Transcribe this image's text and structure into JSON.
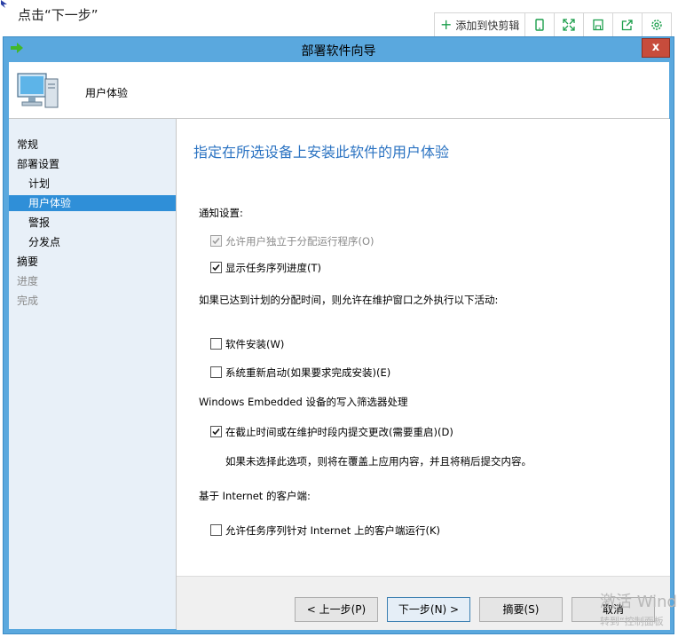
{
  "caption": "点击“下一步”",
  "toolbar": {
    "add_label": "添加到快剪辑",
    "icons": [
      "phone-icon",
      "expand-icon",
      "save-icon",
      "share-icon",
      "settings-icon"
    ]
  },
  "window": {
    "title": "部署软件向导",
    "close_label": "x",
    "header_title": "用户体验"
  },
  "nav": {
    "items": [
      {
        "label": "常规"
      },
      {
        "label": "部署设置"
      },
      {
        "label": "计划"
      },
      {
        "label": "用户体验"
      },
      {
        "label": "警报"
      },
      {
        "label": "分发点"
      },
      {
        "label": "摘要"
      },
      {
        "label": "进度"
      },
      {
        "label": "完成"
      }
    ]
  },
  "content": {
    "title": "指定在所选设备上安装此软件的用户体验",
    "notify_heading": "通知设置:",
    "cb_allow_independent": "允许用户独立于分配运行程序(O)",
    "cb_show_progress": "显示任务序列进度(T)",
    "deadline_text": "如果已达到计划的分配时间，则允许在维护窗口之外执行以下活动:",
    "cb_software_install": "软件安装(W)",
    "cb_system_restart": "系统重新启动(如果要求完成安装)(E)",
    "embedded_heading": "Windows Embedded 设备的写入筛选器处理",
    "cb_commit_changes": "在截止时间或在维护时段内提交更改(需要重启)(D)",
    "commit_note": "如果未选择此选项，则将在覆盖上应用内容，并且将稍后提交内容。",
    "internet_heading": "基于 Internet 的客户端:",
    "cb_internet_clients": "允许任务序列针对 Internet 上的客户端运行(K)"
  },
  "buttons": {
    "prev": "< 上一步(P)",
    "next": "下一步(N) >",
    "summary": "摘要(S)",
    "cancel": "取消"
  },
  "watermark": {
    "line1": "激活 Wind",
    "line2": "转到“控制面板"
  },
  "colors": {
    "titlebar": "#5aa8de",
    "nav_bg": "#e8f0f8",
    "nav_selected": "#2f8fd8",
    "title_blue": "#2b73c2",
    "close_red": "#c74c3c"
  }
}
